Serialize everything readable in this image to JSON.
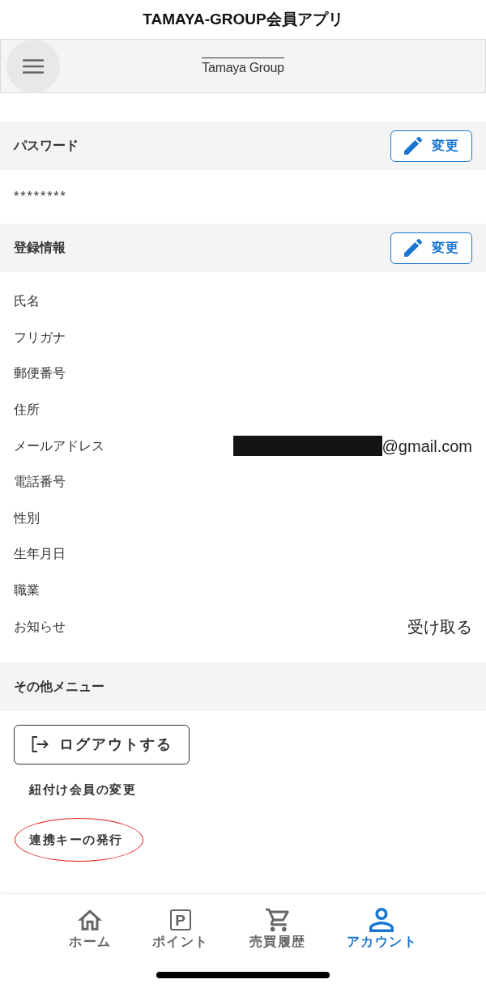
{
  "app_title": "TAMAYA-GROUP会員アプリ",
  "header": {
    "logo": "Tamaya Group"
  },
  "sections": [
    {
      "kind": "text",
      "title": "パスワード",
      "edit_button": "変更",
      "value": "********"
    },
    {
      "kind": "fields",
      "title": "登録情報",
      "edit_button": "変更",
      "fields": [
        {
          "label": "氏名",
          "redacted": false
        },
        {
          "label": "フリガナ",
          "redacted": false
        },
        {
          "label": "郵便番号",
          "redacted": false
        },
        {
          "label": "住所",
          "redacted": false
        },
        {
          "label": "メールアドレス",
          "value": "@gmail.com",
          "redacted": true
        },
        {
          "label": "電話番号",
          "redacted": false
        },
        {
          "label": "性別",
          "redacted": false
        },
        {
          "label": "生年月日",
          "redacted": false
        },
        {
          "label": "職業",
          "redacted": false
        },
        {
          "label": "お知らせ",
          "value": "受け取る",
          "redacted": false
        }
      ]
    },
    {
      "kind": "menu",
      "title": "その他メニュー",
      "logout_button": "ログアウトする",
      "items": [
        {
          "label": "紐付け会員の変更",
          "circled": false
        },
        {
          "label": "連携キーの発行",
          "circled": true
        }
      ]
    }
  ],
  "bottom_nav": [
    {
      "kind": "home",
      "label": "ホーム",
      "selected": false
    },
    {
      "kind": "letter",
      "icon_letter": "P",
      "label": "ポイント",
      "selected": false
    },
    {
      "kind": "cart",
      "label": "売買履歴",
      "selected": false
    },
    {
      "kind": "person",
      "label": "アカウント",
      "selected": true
    }
  ]
}
